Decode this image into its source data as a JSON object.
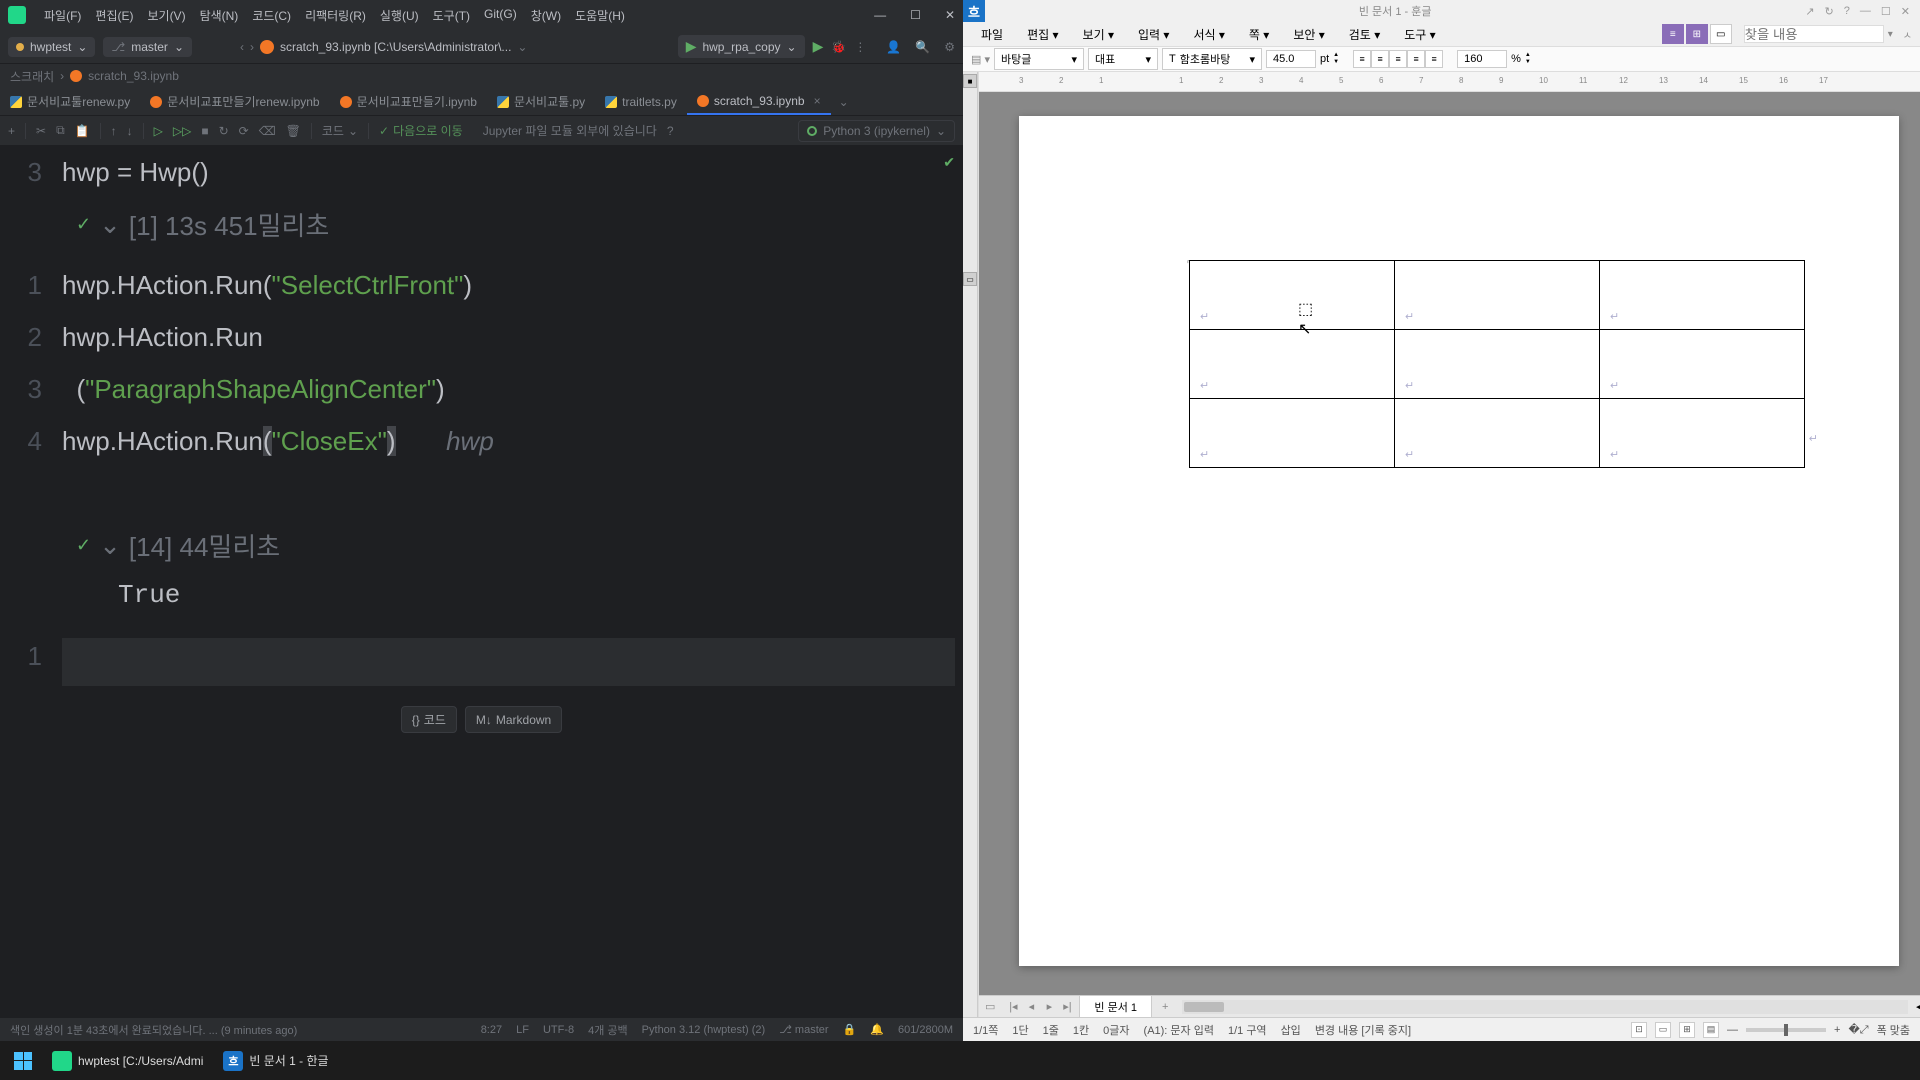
{
  "pycharm": {
    "menu": [
      "파일(F)",
      "편집(E)",
      "보기(V)",
      "탐색(N)",
      "코드(C)",
      "리팩터링(R)",
      "실행(U)",
      "도구(T)",
      "Git(G)",
      "창(W)",
      "도움말(H)"
    ],
    "project": "hwptest",
    "branch": "master",
    "tab_path": "scratch_93.ipynb  [C:\\Users\\Administrator\\...",
    "run_config": "hwp_rpa_copy",
    "breadcrumb": [
      "스크래치",
      "scratch_93.ipynb"
    ],
    "tabs": [
      {
        "icon": "py",
        "label": "문서비교툴renew.py"
      },
      {
        "icon": "ipynb",
        "label": "문서비교표만들기renew.ipynb"
      },
      {
        "icon": "ipynb",
        "label": "문서비교표만들기.ipynb"
      },
      {
        "icon": "py",
        "label": "문서비교툴.py"
      },
      {
        "icon": "py",
        "label": "traitlets.py"
      },
      {
        "icon": "ipynb",
        "label": "scratch_93.ipynb",
        "active": true,
        "close": true
      }
    ],
    "nb_toolbar": {
      "code_label": "코드",
      "next_move": "다음으로 이동",
      "jupyter_hint": "Jupyter 파일 모듈 외부에 있습니다",
      "kernel": "Python 3 (ipykernel)"
    },
    "cell0": {
      "line": "3",
      "code_plain": "hwp = Hwp()",
      "meta": "[1]  13s 451밀리초"
    },
    "cell1": {
      "lines": [
        "1",
        "2",
        "",
        "3",
        "4"
      ],
      "l1": "hwp.HAction.Run(\"SelectCtrlFront\")",
      "l2a": "hwp.HAction.Run",
      "l2b": "(\"ParagraphShapeAlignCenter\")",
      "l3": "hwp.HAction.Run(\"CloseEx\")",
      "l3_hint": "hwp",
      "meta": "[14]  44밀리초",
      "output": "True"
    },
    "cell2_line": "1",
    "add_code": "코드",
    "add_md": "Markdown",
    "status": {
      "left": "색인 생성이 1분 43초에서 완료되었습니다. ... (9 minutes ago)",
      "pos": "8:27",
      "le": "LF",
      "enc": "UTF-8",
      "indent": "4개 공백",
      "interp": "Python 3.12 (hwptest) (2)",
      "branch": "master",
      "mem": "601/2800M"
    }
  },
  "hangul": {
    "title": "빈 문서 1 - 훈글",
    "menu": [
      "파일",
      "편집",
      "보기",
      "입력",
      "서식",
      "쪽",
      "보안",
      "검토",
      "도구"
    ],
    "search_placeholder": "찾을 내용",
    "toolbar": {
      "style": "바탕글",
      "rep": "대표",
      "font": "함초롬바탕",
      "size": "45.0",
      "unit": "pt",
      "spacing": "160",
      "pct": "%"
    },
    "hruler_marks": [
      "3",
      "2",
      "1",
      "",
      "1",
      "2",
      "3",
      "4",
      "5",
      "6",
      "7",
      "8",
      "9",
      "10",
      "11",
      "12",
      "13",
      "14",
      "15",
      "16",
      "17"
    ],
    "doctab": "빈 문서 1",
    "status": {
      "page": "1/1쪽",
      "para": "1단",
      "line": "1줄",
      "col": "1칸",
      "char": "0글자",
      "mode": "(A1): 문자 입력",
      "section": "1/1 구역",
      "insert": "삽입",
      "track": "변경 내용 [기록 중지]",
      "fit": "폭 맞춤"
    }
  },
  "taskbar": {
    "pycharm": "hwptest [C:/Users/Admi",
    "hangul": "빈 문서 1 - 한글"
  }
}
